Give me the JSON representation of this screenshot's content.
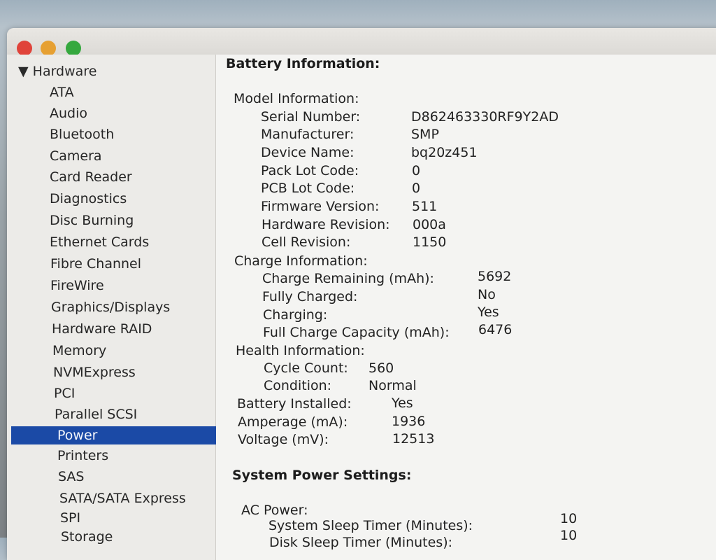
{
  "sidebar": {
    "header": "▼ Hardware",
    "items": [
      "ATA",
      "Audio",
      "Bluetooth",
      "Camera",
      "Card Reader",
      "Diagnostics",
      "Disc Burning",
      "Ethernet Cards",
      "Fibre Channel",
      "FireWire",
      "Graphics/Displays",
      "Hardware RAID",
      "Memory",
      "NVMExpress",
      "PCI",
      "Parallel SCSI",
      "Power",
      "Printers",
      "SAS",
      "SATA/SATA Express",
      "SPI",
      "Storage"
    ],
    "selected": "Power"
  },
  "content": {
    "section_title": "Battery Information:",
    "model_heading": "Model Information:",
    "model": [
      {
        "label": "Serial Number:",
        "value": "D862463330RF9Y2AD"
      },
      {
        "label": "Manufacturer:",
        "value": "SMP"
      },
      {
        "label": "Device Name:",
        "value": "bq20z451"
      },
      {
        "label": "Pack Lot Code:",
        "value": "0"
      },
      {
        "label": "PCB Lot Code:",
        "value": "0"
      },
      {
        "label": "Firmware Version:",
        "value": "511"
      },
      {
        "label": "Hardware Revision:",
        "value": "000a"
      },
      {
        "label": "Cell Revision:",
        "value": "1150"
      }
    ],
    "charge_heading": "Charge Information:",
    "charge": [
      {
        "label": "Charge Remaining (mAh):",
        "value": "5692"
      },
      {
        "label": "Fully Charged:",
        "value": "No"
      },
      {
        "label": "Charging:",
        "value": "Yes"
      },
      {
        "label": "Full Charge Capacity (mAh):",
        "value": "6476"
      }
    ],
    "health_heading": "Health Information:",
    "health": [
      {
        "label": "Cycle Count:",
        "value": "560"
      },
      {
        "label": "Condition:",
        "value": "Normal"
      }
    ],
    "battery_misc": [
      {
        "label": "Battery Installed:",
        "value": "Yes"
      },
      {
        "label": "Amperage (mA):",
        "value": "1936"
      },
      {
        "label": "Voltage (mV):",
        "value": "12513"
      }
    ],
    "power_settings_title": "System Power Settings:",
    "ac_heading": "AC Power:",
    "ac": [
      {
        "label": "System Sleep Timer (Minutes):",
        "value": "10"
      },
      {
        "label": "Disk Sleep Timer (Minutes):",
        "value": "10"
      }
    ]
  }
}
